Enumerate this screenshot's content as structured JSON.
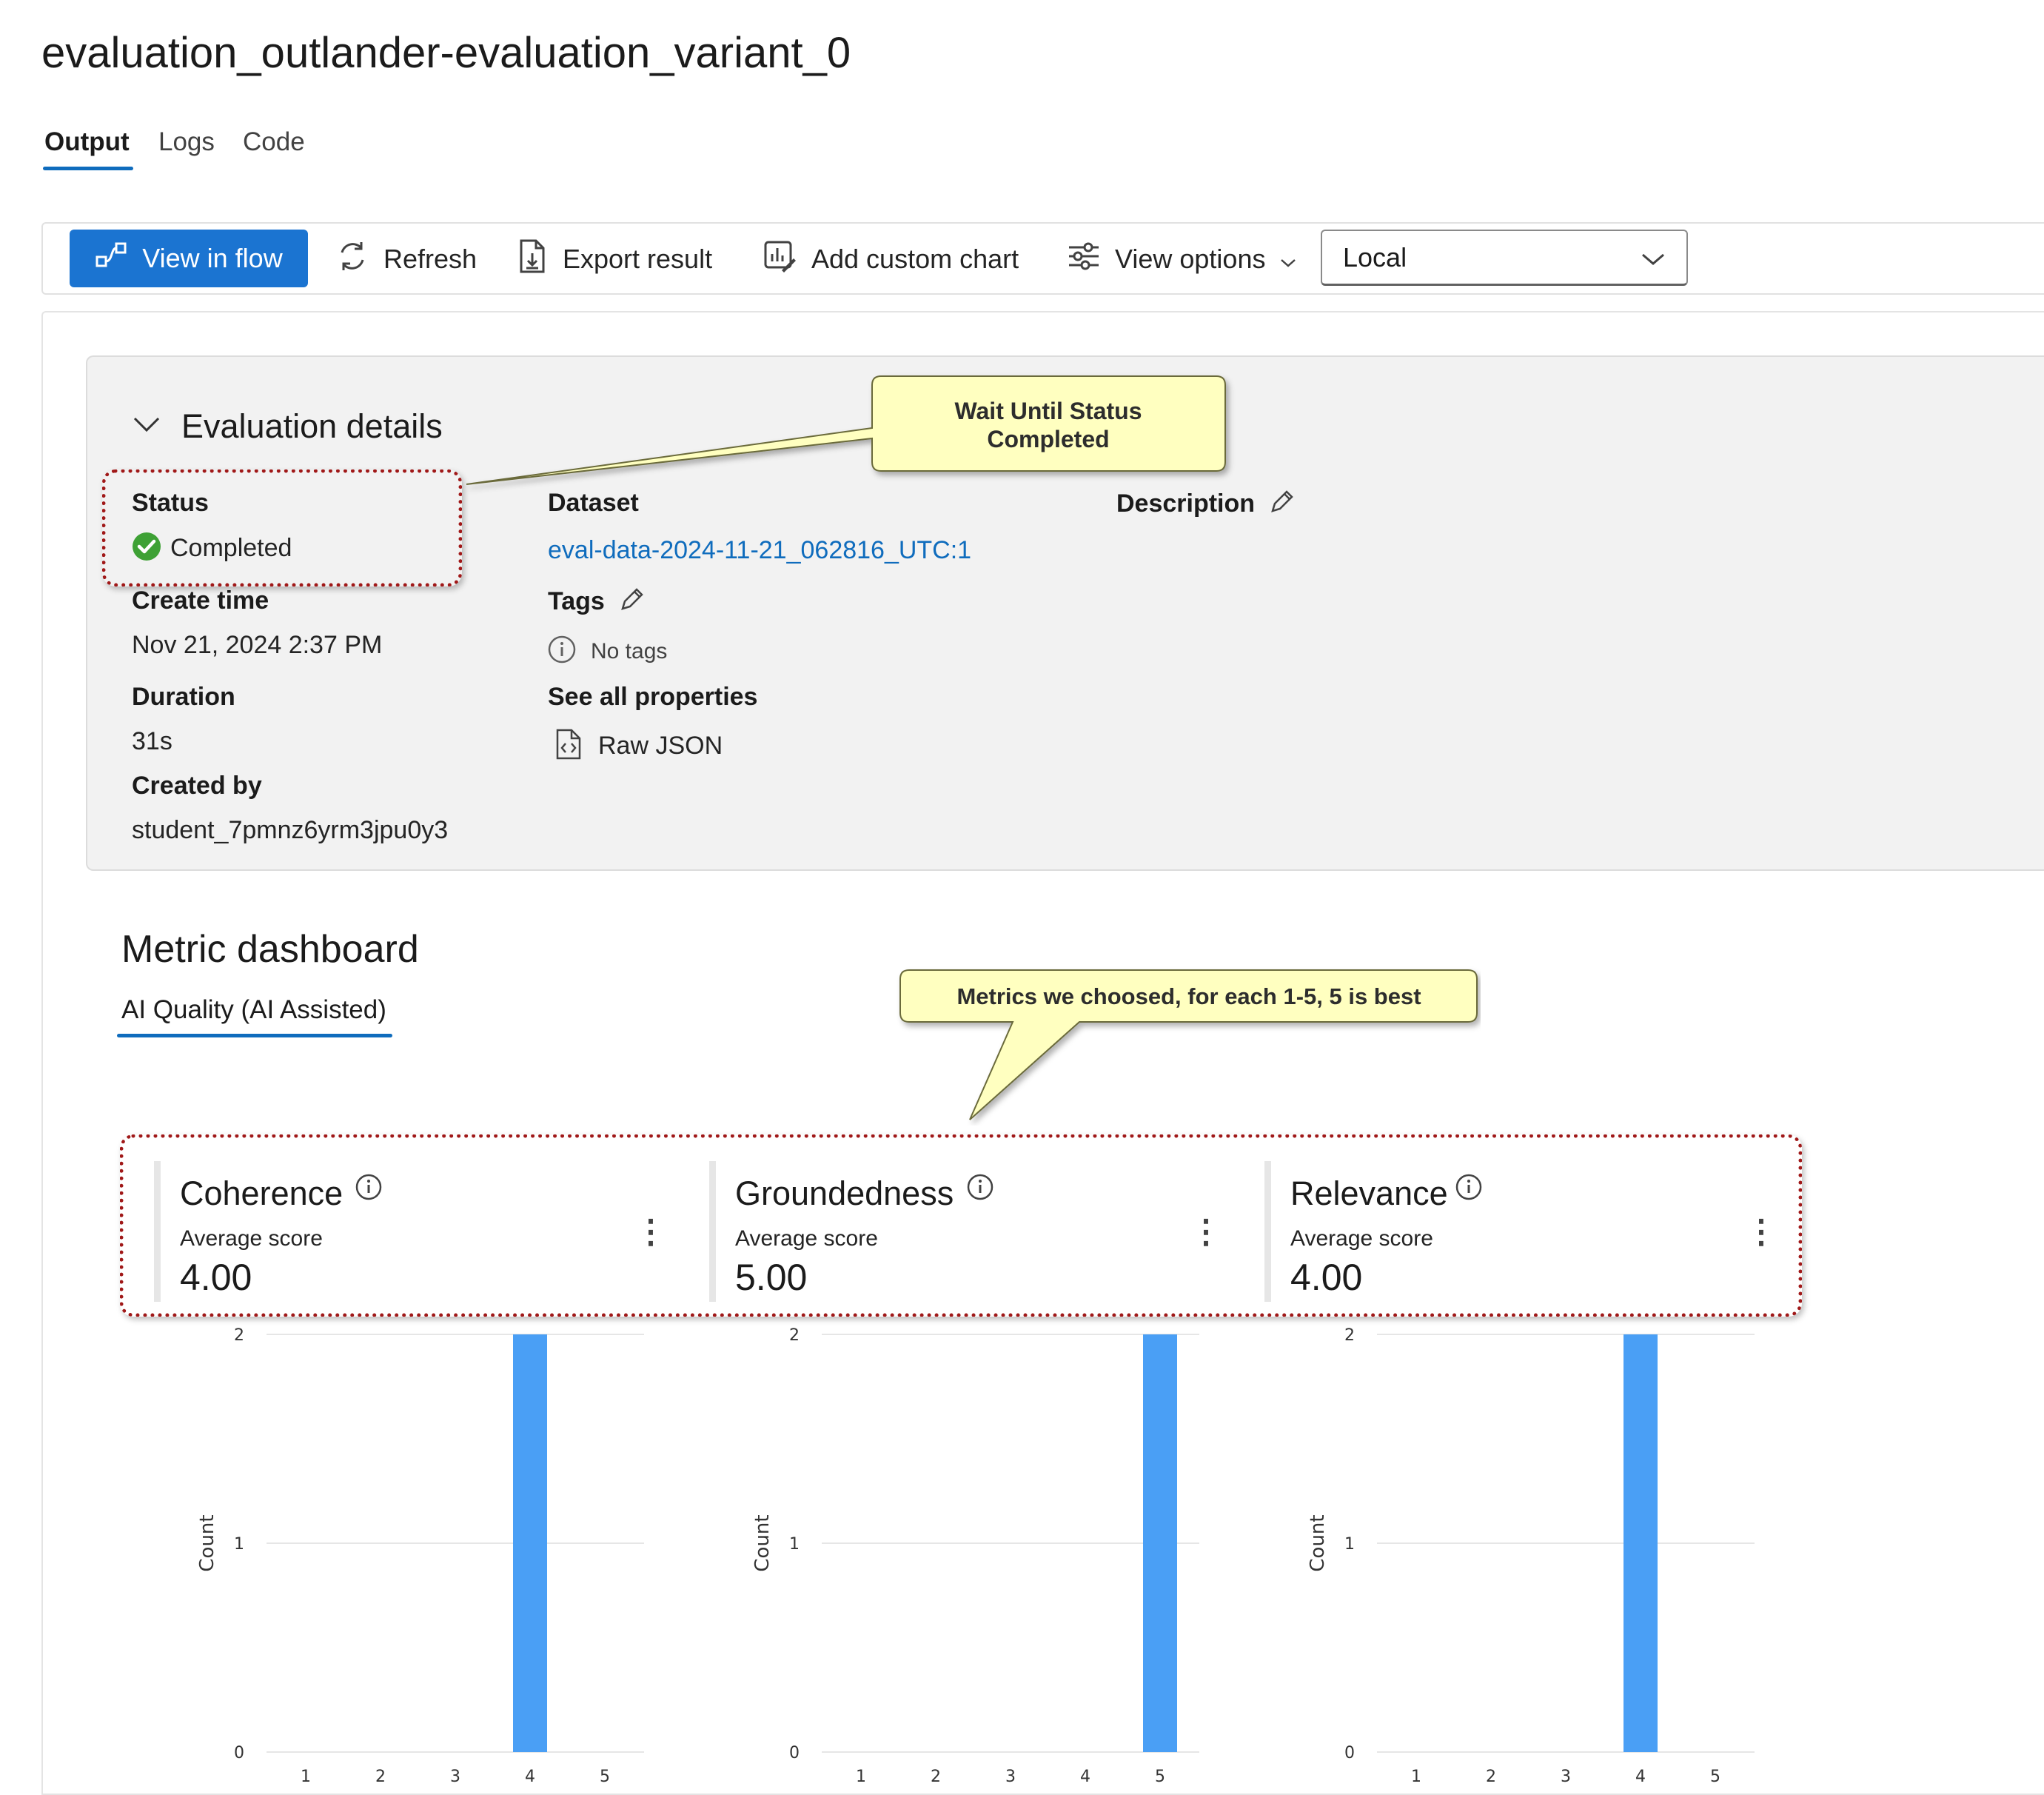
{
  "title": "evaluation_outlander-evaluation_variant_0",
  "tabs": [
    {
      "label": "Output",
      "active": true
    },
    {
      "label": "Logs",
      "active": false
    },
    {
      "label": "Code",
      "active": false
    }
  ],
  "toolbar": {
    "view_in_flow": "View in flow",
    "refresh": "Refresh",
    "export_result": "Export result",
    "add_custom_chart": "Add custom chart",
    "view_options": "View options",
    "environment_select": "Local"
  },
  "details": {
    "heading": "Evaluation details",
    "status_label": "Status",
    "status_value": "Completed",
    "create_time_label": "Create time",
    "create_time_value": "Nov 21, 2024 2:37 PM",
    "duration_label": "Duration",
    "duration_value": "31s",
    "created_by_label": "Created by",
    "created_by_value": "student_7pmnz6yrm3jpu0y3",
    "dataset_label": "Dataset",
    "dataset_value": "eval-data-2024-11-21_062816_UTC:1",
    "tags_label": "Tags",
    "tags_value": "No tags",
    "see_all_label": "See all properties",
    "raw_json": "Raw JSON",
    "description_label": "Description"
  },
  "callouts": {
    "status_note_line1": "Wait Until Status",
    "status_note_line2": "Completed",
    "metrics_note": "Metrics we choosed, for each 1-5, 5 is best"
  },
  "dashboard": {
    "heading": "Metric dashboard",
    "subtab": "AI Quality (AI Assisted)",
    "metrics": [
      {
        "name": "Coherence",
        "sub": "Average score",
        "value": "4.00"
      },
      {
        "name": "Groundedness",
        "sub": "Average score",
        "value": "5.00"
      },
      {
        "name": "Relevance",
        "sub": "Average score",
        "value": "4.00"
      }
    ]
  },
  "colors": {
    "accent": "#1b74d1",
    "link": "#0f6cbd",
    "bar": "#4a9ff5",
    "success": "#3ea135",
    "annotation_border": "#a01818",
    "callout_fill": "#ffffc0"
  },
  "chart_data": [
    {
      "type": "bar",
      "categories": [
        "1",
        "2",
        "3",
        "4",
        "5"
      ],
      "values": [
        0,
        0,
        0,
        2,
        0
      ],
      "ylabel": "Count",
      "ylim": [
        0,
        2
      ],
      "yticks": [
        "0",
        "1",
        "2"
      ]
    },
    {
      "type": "bar",
      "categories": [
        "1",
        "2",
        "3",
        "4",
        "5"
      ],
      "values": [
        0,
        0,
        0,
        0,
        2
      ],
      "ylabel": "Count",
      "ylim": [
        0,
        2
      ],
      "yticks": [
        "0",
        "1",
        "2"
      ]
    },
    {
      "type": "bar",
      "categories": [
        "1",
        "2",
        "3",
        "4",
        "5"
      ],
      "values": [
        0,
        0,
        0,
        2,
        0
      ],
      "ylabel": "Count",
      "ylim": [
        0,
        2
      ],
      "yticks": [
        "0",
        "1",
        "2"
      ]
    }
  ]
}
